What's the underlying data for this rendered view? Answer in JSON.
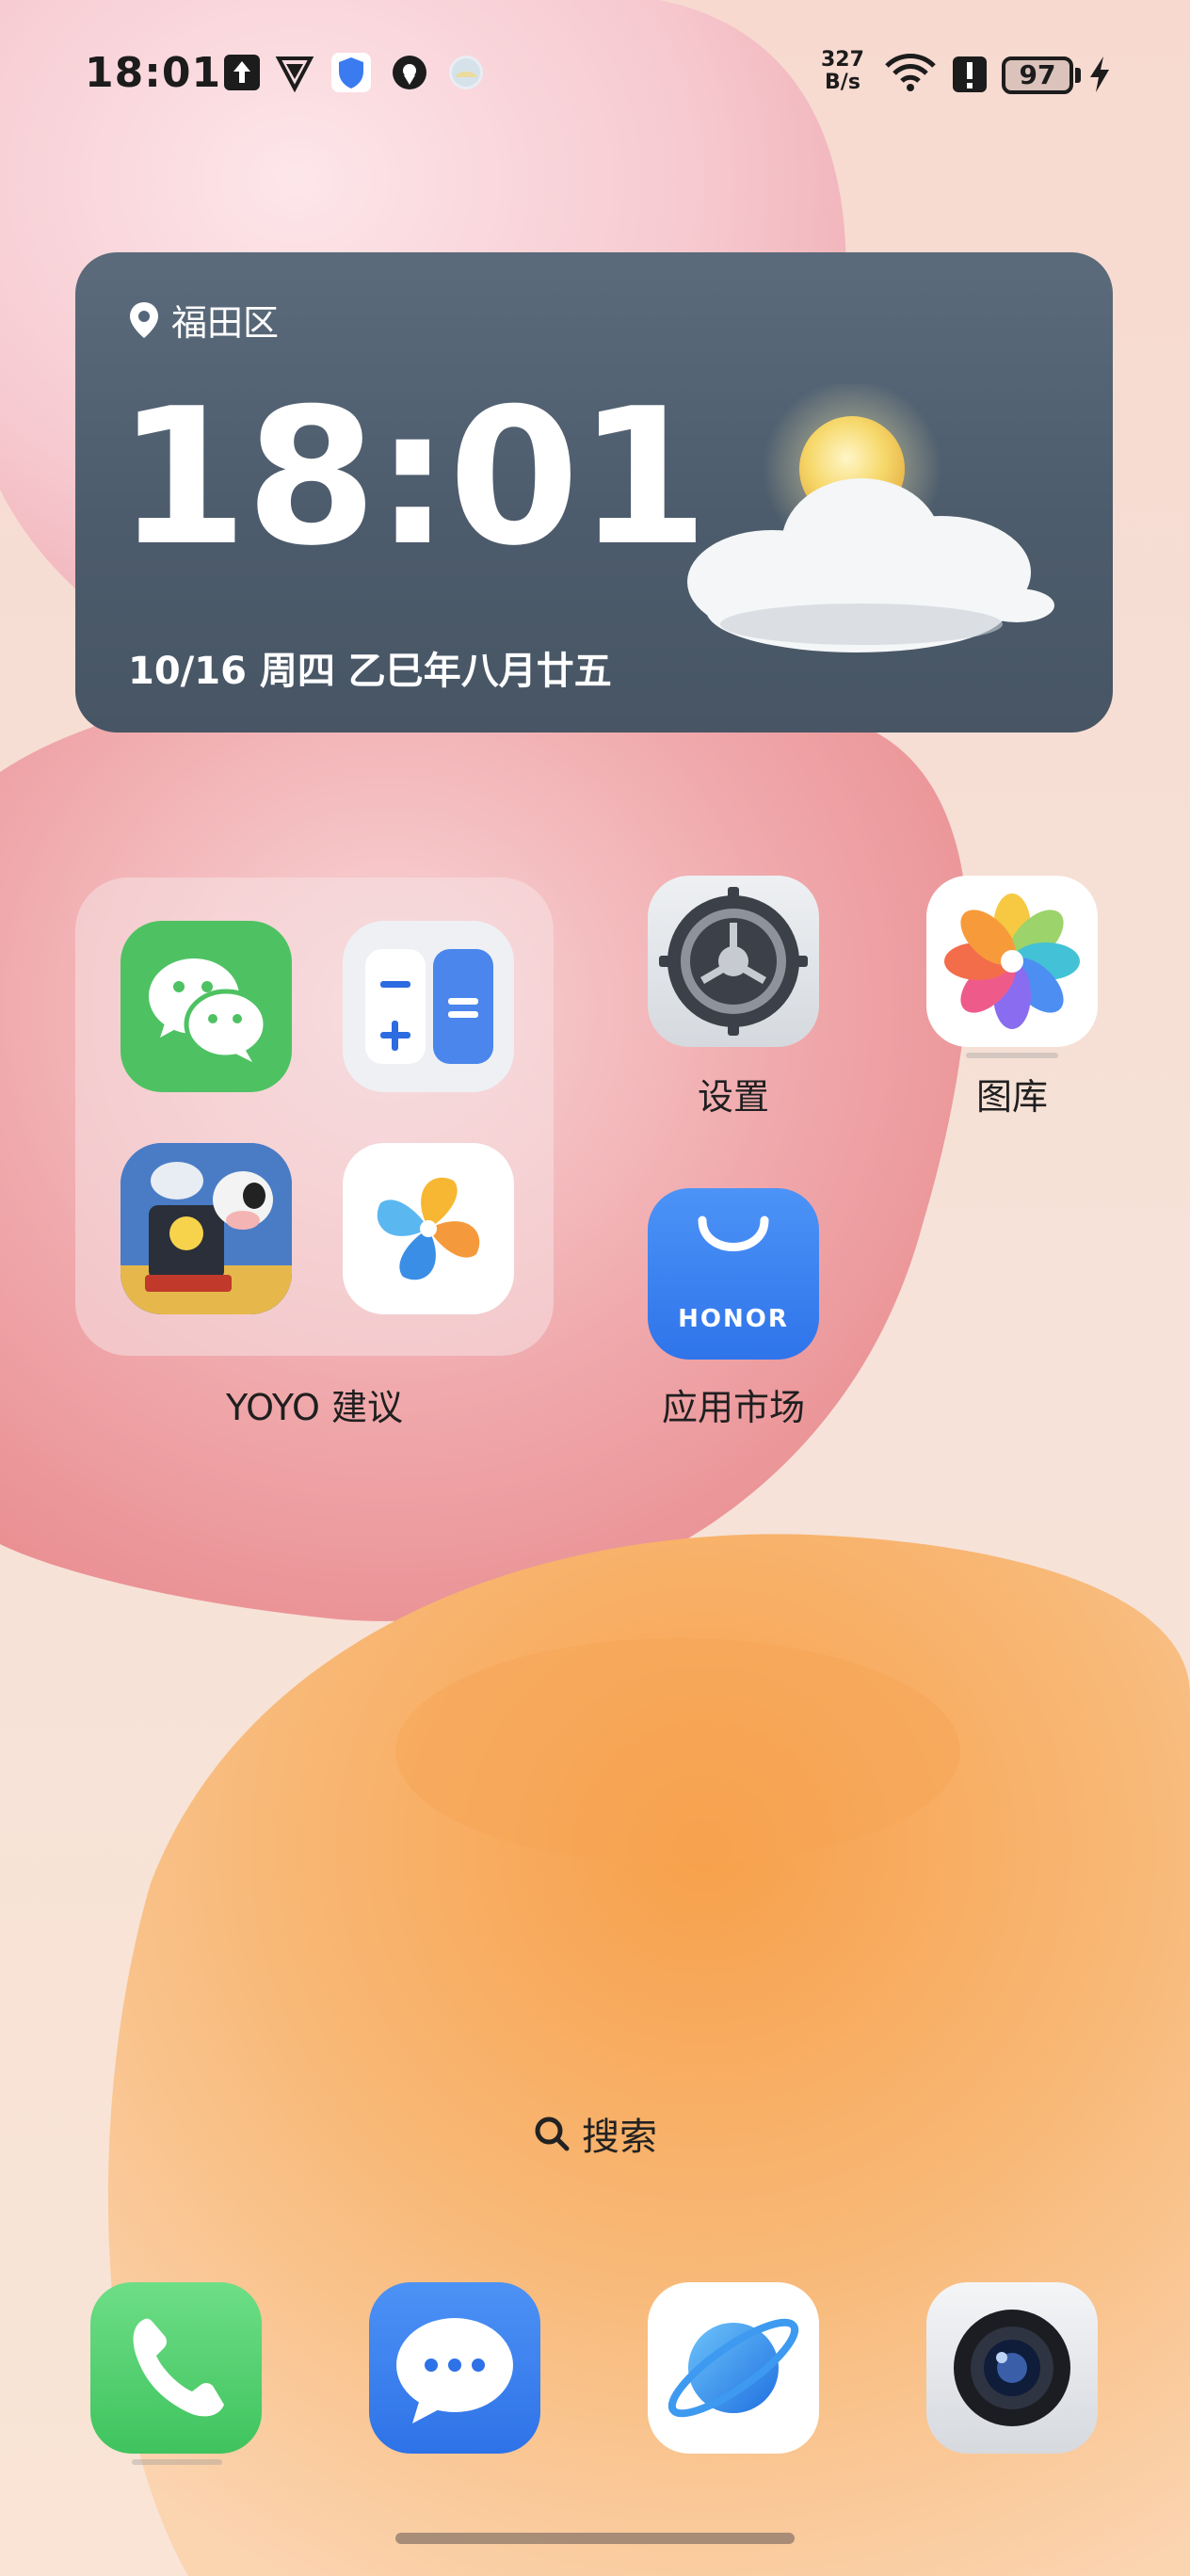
{
  "status_bar": {
    "time": "18:01",
    "net_speed_value": "327",
    "net_speed_unit": "B/s",
    "battery": "97"
  },
  "weather_widget": {
    "location": "福田区",
    "time": "18:01",
    "date": "10/16 周四  乙巳年八月廿五",
    "condition_icon": "partly-cloudy-icon"
  },
  "folder": {
    "label": "YOYO 建议",
    "apps": [
      "wechat-icon",
      "calculator-icon",
      "train-game-icon",
      "pinwheel-app-icon"
    ]
  },
  "apps": {
    "settings_label": "设置",
    "gallery_label": "图库",
    "appmarket_label": "应用市场",
    "appmarket_brand": "HONOR"
  },
  "search": {
    "label": "搜索"
  },
  "dock": [
    "phone-icon",
    "messages-icon",
    "browser-icon",
    "camera-icon"
  ],
  "colors": {
    "widget_bg": "#56667a",
    "wechat_green": "#4ec262",
    "honor_blue": "#3d86f5"
  }
}
